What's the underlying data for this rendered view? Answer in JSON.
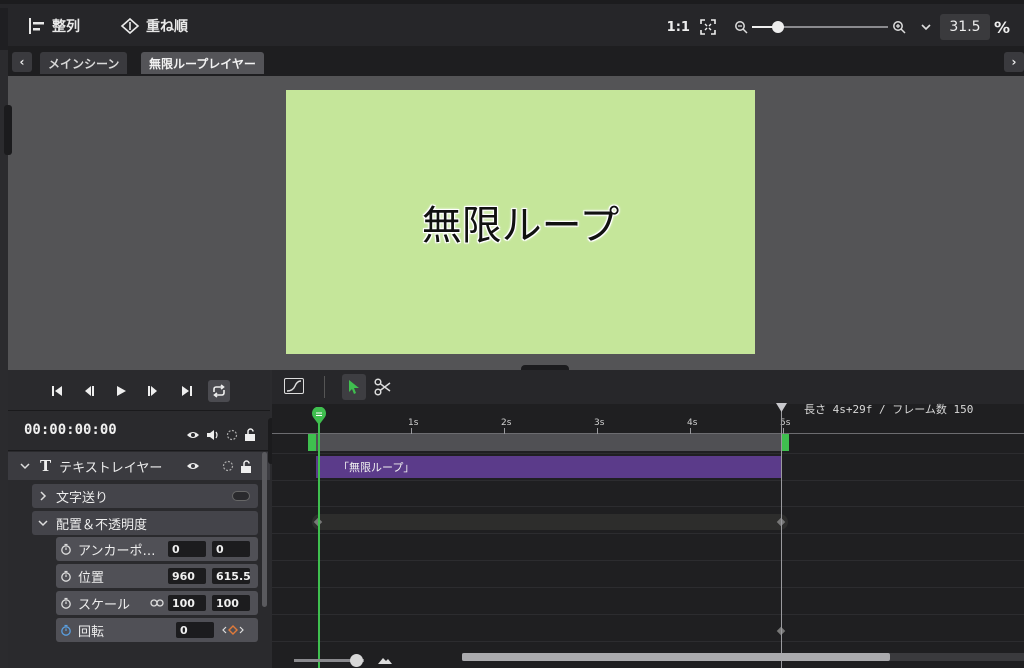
{
  "toolbar": {
    "align_label": "整列",
    "order_label": "重ね順",
    "ratio_label": "1:1",
    "zoom_value": "31.5",
    "zoom_unit": "%",
    "zoom_slider_fraction": 0.2
  },
  "tabs": [
    {
      "label": "メインシーン",
      "active": false
    },
    {
      "label": "無限ループレイヤー",
      "active": true
    }
  ],
  "preview": {
    "canvas_text": "無限ループ",
    "canvas_color": "#c5e69a"
  },
  "player": {
    "timecode": "00:00:00:00"
  },
  "layers": {
    "text_layer_label": "テキストレイヤー",
    "group_text_send": "文字送り",
    "group_placement": "配置＆不透明度",
    "anchor": {
      "label": "アンカーポ…",
      "x": "0",
      "y": "0"
    },
    "position": {
      "label": "位置",
      "x": "960",
      "y": "615.5"
    },
    "scale": {
      "label": "スケール",
      "x": "100",
      "y": "100"
    },
    "rotation": {
      "label": "回転",
      "value": "0"
    }
  },
  "timeline": {
    "ticks": [
      "1s",
      "2s",
      "3s",
      "4s",
      "5s"
    ],
    "length_info": "長さ 4s+29f / フレーム数 150",
    "clip_label": "「無限ループ」"
  },
  "colors": {
    "accent_green": "#3fbf4f",
    "clip_purple": "#5b3b8a"
  }
}
